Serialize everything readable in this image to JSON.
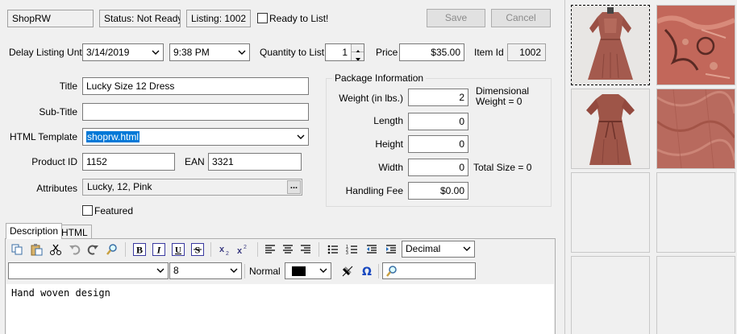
{
  "header": {
    "store": "ShopRW",
    "status": "Status: Not Ready",
    "listing": "Listing: 1002",
    "ready_label": "Ready to List!",
    "save_label": "Save",
    "cancel_label": "Cancel"
  },
  "schedule": {
    "delay_label": "Delay Listing Until",
    "date": "3/14/2019",
    "time": "9:38 PM",
    "qty_label": "Quantity to List",
    "qty": "1",
    "price_label": "Price",
    "price": "$35.00",
    "itemid_label": "Item Id",
    "itemid": "1002"
  },
  "form": {
    "title_label": "Title",
    "title": "Lucky Size 12 Dress",
    "subtitle_label": "Sub-Title",
    "subtitle": "",
    "template_label": "HTML Template",
    "template": "shoprw.html",
    "productid_label": "Product ID",
    "productid": "1152",
    "ean_label": "EAN",
    "ean": "3321",
    "attributes_label": "Attributes",
    "attributes": "Lucky, 12, Pink",
    "attributes_btn": "...",
    "featured_label": "Featured"
  },
  "package": {
    "group_title": "Package Information",
    "weight_label": "Weight (in lbs.)",
    "weight": "2",
    "dim_label_1": "Dimensional",
    "dim_label_2": "Weight = 0",
    "length_label": "Length",
    "length": "0",
    "height_label": "Height",
    "height": "0",
    "width_label": "Width",
    "width": "0",
    "total_size": "Total Size = 0",
    "handling_label": "Handling Fee",
    "handling": "$0.00"
  },
  "tabs": [
    {
      "label": "Description"
    },
    {
      "label": "HTML"
    }
  ],
  "editor": {
    "list_style": "Decimal",
    "font_name": "",
    "font_size": "8",
    "paragraph": "Normal",
    "text_color": "#000000",
    "content": "Hand woven design"
  },
  "colors": {
    "accent": "#0078d7",
    "dress": "#a45a4e"
  },
  "gallery": {
    "images": [
      {
        "icon": "dress-front-photo"
      },
      {
        "icon": "embroidery-detail-photo"
      },
      {
        "icon": "dress-back-photo"
      },
      {
        "icon": "fabric-detail-photo"
      }
    ]
  }
}
